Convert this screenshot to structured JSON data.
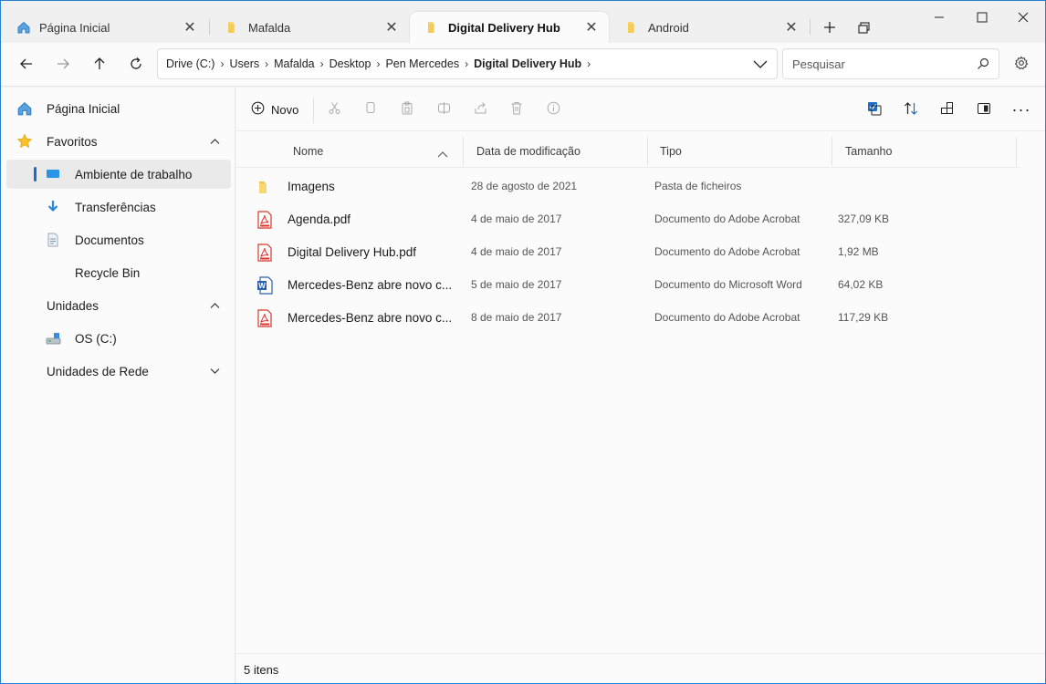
{
  "tabs": [
    {
      "label": "Página Inicial",
      "icon": "home-icon"
    },
    {
      "label": "Mafalda",
      "icon": "folder-icon"
    },
    {
      "label": "Digital Delivery Hub",
      "icon": "folder-icon"
    },
    {
      "label": "Android",
      "icon": "folder-icon"
    }
  ],
  "breadcrumb": [
    "Drive (C:)",
    "Users",
    "Mafalda",
    "Desktop",
    "Pen Mercedes",
    "Digital Delivery Hub"
  ],
  "search": {
    "placeholder": "Pesquisar"
  },
  "sidebar": {
    "home": "Página Inicial",
    "favorites": "Favoritos",
    "fav_items": [
      "Ambiente de trabalho",
      "Transferências",
      "Documentos",
      "Recycle Bin"
    ],
    "drives": "Unidades",
    "drive_items": [
      "OS (C:)"
    ],
    "network": "Unidades de Rede"
  },
  "toolbar": {
    "new_label": "Novo"
  },
  "columns": {
    "name": "Nome",
    "date": "Data de modificação",
    "type": "Tipo",
    "size": "Tamanho"
  },
  "files": [
    {
      "name": "Imagens",
      "date": "28 de agosto de 2021",
      "type": "Pasta de ficheiros",
      "size": "",
      "icon": "folder-icon"
    },
    {
      "name": "Agenda.pdf",
      "date": "4 de maio de 2017",
      "type": "Documento do Adobe Acrobat",
      "size": "327,09 KB",
      "icon": "pdf-icon"
    },
    {
      "name": "Digital Delivery Hub.pdf",
      "date": "4 de maio de 2017",
      "type": "Documento do Adobe Acrobat",
      "size": "1,92 MB",
      "icon": "pdf-icon"
    },
    {
      "name": "Mercedes-Benz abre novo c...",
      "date": "5 de maio de 2017",
      "type": "Documento do Microsoft Word",
      "size": "64,02 KB",
      "icon": "word-icon"
    },
    {
      "name": "Mercedes-Benz abre novo c...",
      "date": "8 de maio de 2017",
      "type": "Documento do Adobe Acrobat",
      "size": "117,29 KB",
      "icon": "pdf-icon"
    }
  ],
  "status": {
    "count": "5 itens"
  },
  "colors": {
    "accent": "#1a6fc4",
    "folder": "#f8d775",
    "pdf": "#d9352b",
    "word": "#2b5fb4"
  }
}
